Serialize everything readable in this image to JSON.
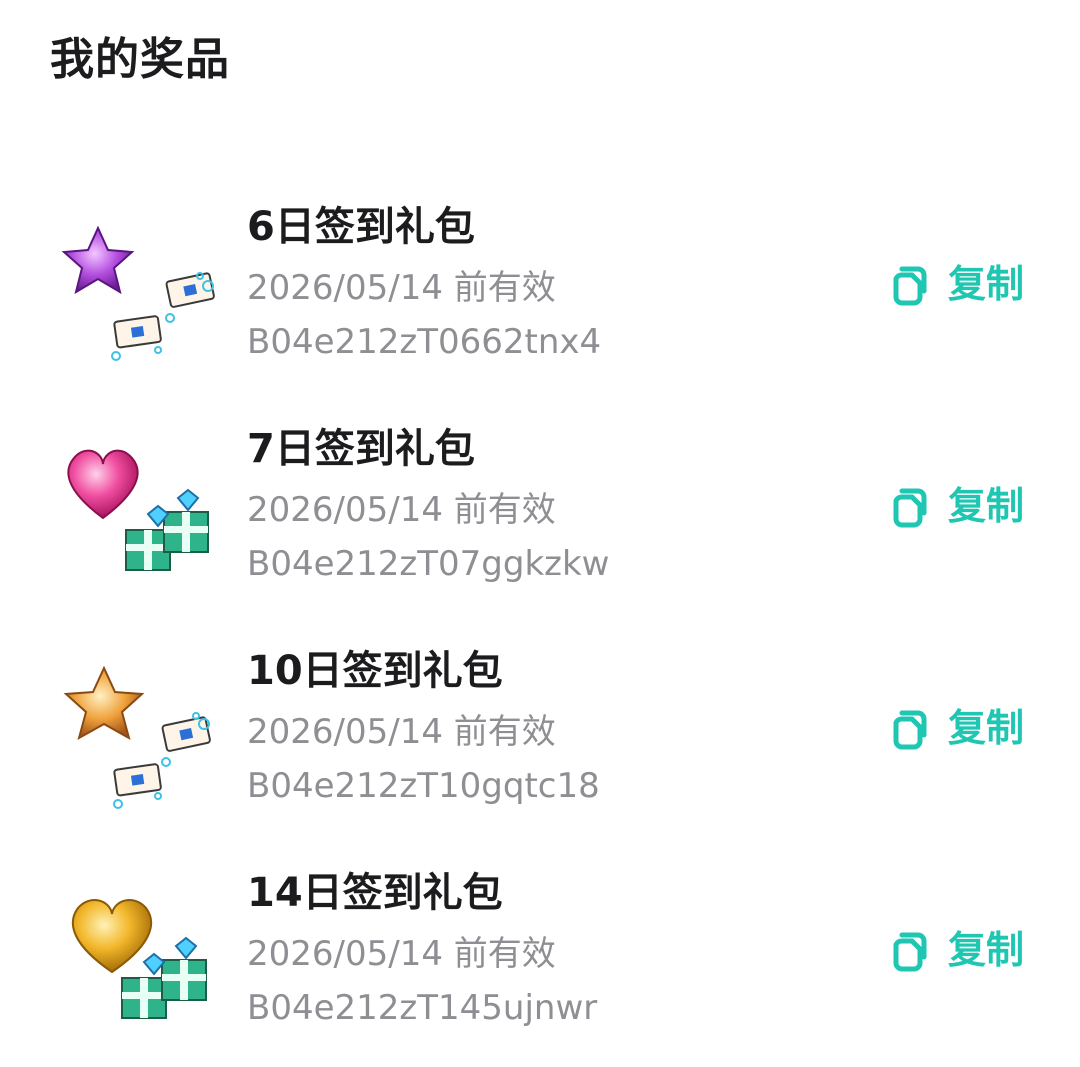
{
  "page": {
    "title": "我的奖品"
  },
  "accent_color": "#1fc6b1",
  "prizes": [
    {
      "name": "6日签到礼包",
      "expiry": "2026/05/14 前有效",
      "code": "B04e212zT0662tnx4",
      "copy_label": "复制",
      "icon": "purple-star-with-tickets-icon"
    },
    {
      "name": "7日签到礼包",
      "expiry": "2026/05/14 前有效",
      "code": "B04e212zT07ggkzkw",
      "copy_label": "复制",
      "icon": "pink-heart-with-gift-boxes-icon"
    },
    {
      "name": "10日签到礼包",
      "expiry": "2026/05/14 前有效",
      "code": "B04e212zT10gqtc18",
      "copy_label": "复制",
      "icon": "orange-star-with-tickets-icon"
    },
    {
      "name": "14日签到礼包",
      "expiry": "2026/05/14 前有效",
      "code": "B04e212zT145ujnwr",
      "copy_label": "复制",
      "icon": "gold-heart-with-gift-boxes-icon"
    }
  ]
}
